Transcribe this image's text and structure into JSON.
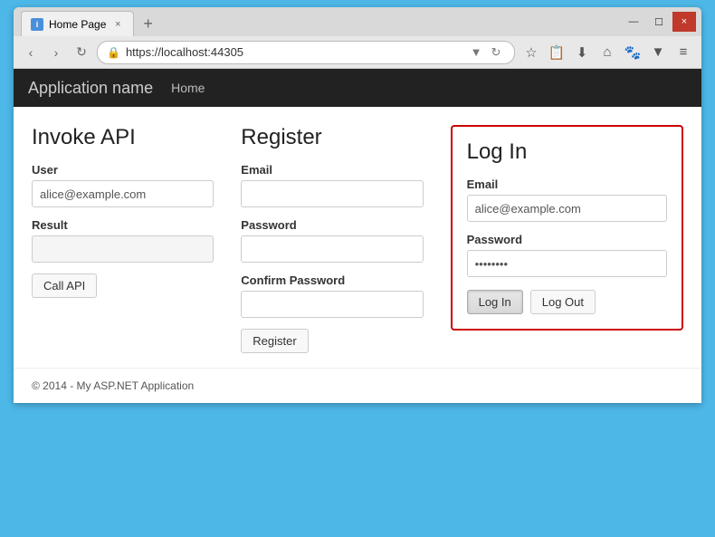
{
  "browser": {
    "tab_title": "Home Page",
    "tab_close": "×",
    "tab_new": "+",
    "url": "https://localhost:44305",
    "nav_back": "‹",
    "nav_forward": "›",
    "nav_refresh": "↻",
    "window_minimize": "—",
    "window_maximize": "☐",
    "window_close": "×"
  },
  "navbar": {
    "app_name": "Application name",
    "home_link": "Home"
  },
  "invoke_api": {
    "title": "Invoke API",
    "user_label": "User",
    "user_value": "alice@example.com",
    "result_label": "Result",
    "call_button": "Call API"
  },
  "register": {
    "title": "Register",
    "email_label": "Email",
    "email_value": "",
    "password_label": "Password",
    "password_value": "",
    "confirm_label": "Confirm Password",
    "confirm_value": "",
    "register_button": "Register"
  },
  "login": {
    "title": "Log In",
    "email_label": "Email",
    "email_value": "alice@example.com",
    "password_label": "Password",
    "password_value": "••••••••",
    "login_button": "Log In",
    "logout_button": "Log Out"
  },
  "footer": {
    "text": "© 2014 - My ASP.NET Application"
  }
}
